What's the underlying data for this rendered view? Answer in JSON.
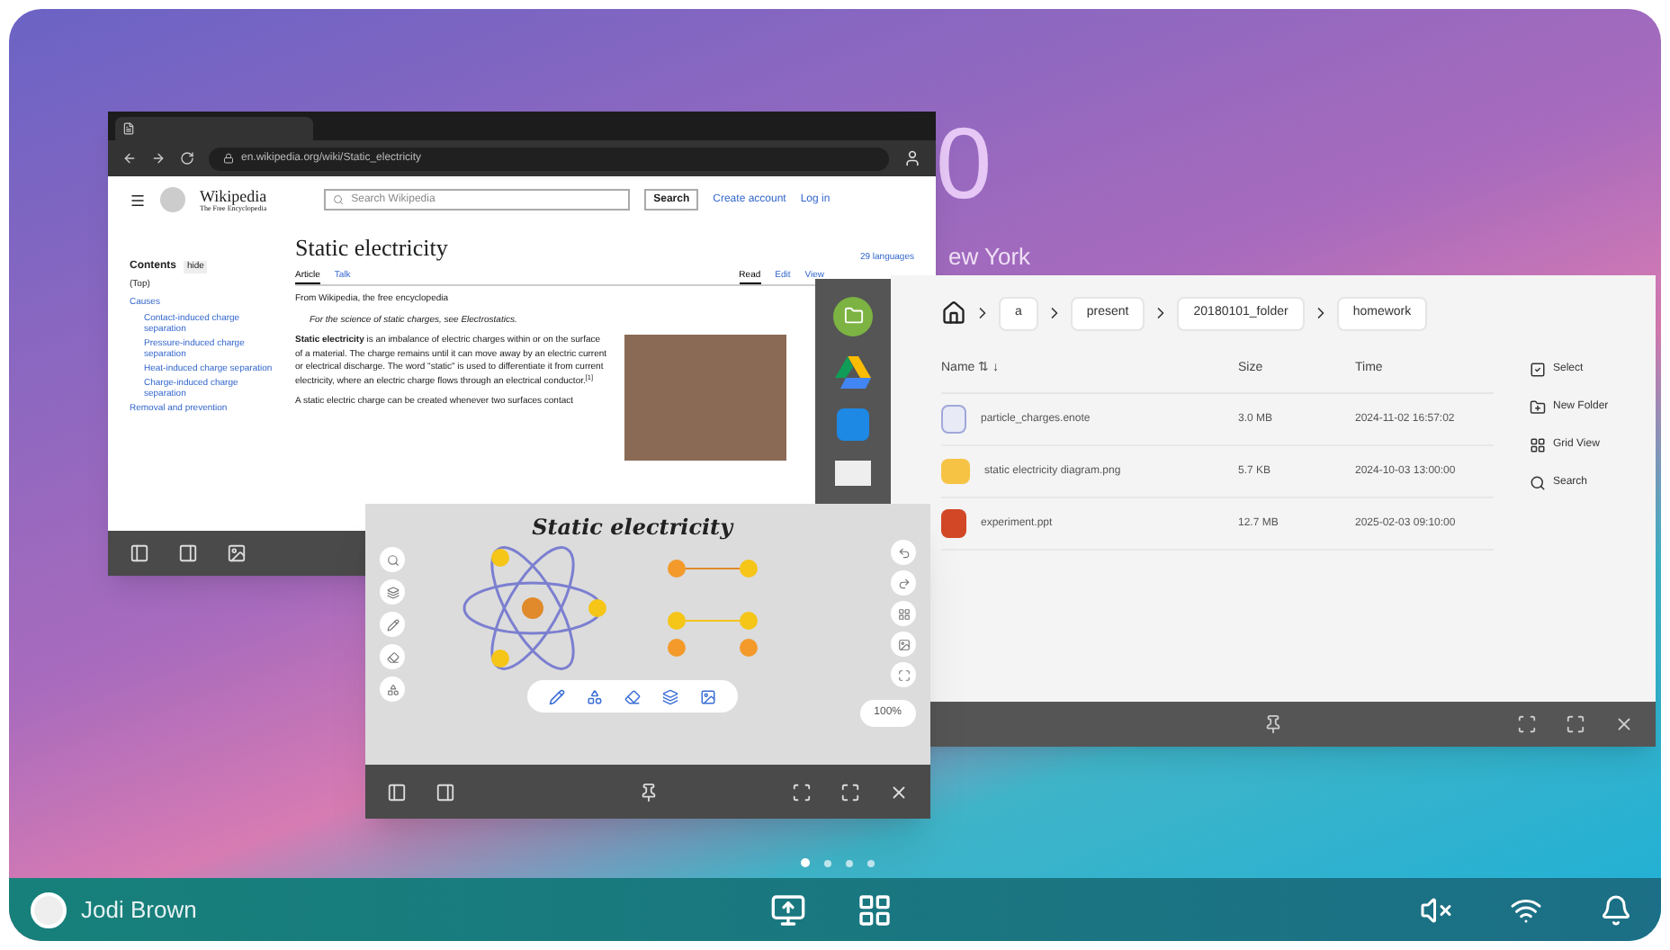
{
  "clock": {
    "time": "0",
    "city": "ew York"
  },
  "browser": {
    "url": "en.wikipedia.org/wiki/Static_electricity",
    "wiki": {
      "logo": "Wikipedia",
      "logo_subtitle": "The Free Encyclopedia",
      "search_placeholder": "Search Wikipedia",
      "search_button": "Search",
      "links": [
        "Create account",
        "Log in"
      ],
      "title": "Static electricity",
      "languages": "29 languages",
      "toc_title": "Contents",
      "toc_hide": "hide",
      "toc": [
        {
          "label": "(Top)"
        },
        {
          "label": "Causes",
          "children": [
            {
              "label": "Contact-induced charge separation"
            },
            {
              "label": "Pressure-induced charge separation"
            },
            {
              "label": "Heat-induced charge separation"
            },
            {
              "label": "Charge-induced charge separation"
            }
          ]
        },
        {
          "label": "Removal and prevention"
        }
      ],
      "tabs_left": [
        {
          "label": "Article",
          "selected": true
        },
        {
          "label": "Talk",
          "selected": false
        }
      ],
      "tabs_right": [
        {
          "label": "Read",
          "selected": true
        },
        {
          "label": "Edit",
          "selected": false
        },
        {
          "label": "View",
          "selected": false
        }
      ],
      "tagline": "From Wikipedia, the free encyclopedia",
      "hatnote": "For the science of static charges, see Electrostatics.",
      "paragraphs": [
        "**Static electricity** is an imbalance of electric charges within or on the surface of a material. The charge remains until it can move away by an electric current or electrical discharge. The word \"static\" is used to differentiate it from current electricity, where an electric charge flows through an electrical conductor.$^{[1]}$",
        "A static electric charge can be created whenever two surfaces contact"
      ]
    }
  },
  "files": {
    "breadcrumb": [
      "a",
      "present",
      "20180101_folder",
      "homework"
    ],
    "columns": [
      "Name ⇅ ↓",
      "Size",
      "Time"
    ],
    "rows": [
      {
        "kind": "note",
        "name": "particle_charges.enote",
        "size": "3.0 MB",
        "time": "2024-11-02 16:57:02"
      },
      {
        "kind": "image",
        "name": "static electricity diagram.png",
        "size": "5.7 KB",
        "time": "2024-10-03 13:00:00"
      },
      {
        "kind": "slides",
        "name": "experiment.ppt",
        "size": "12.7 MB",
        "time": "2025-02-03 09:10:00"
      }
    ],
    "actions": [
      "Select",
      "New Folder",
      "Grid View",
      "Search"
    ]
  },
  "whiteboard": {
    "title": "Static electricity",
    "zoom": "100%"
  },
  "pages": [
    {
      "selected": true
    },
    {
      "selected": false
    },
    {
      "selected": false
    },
    {
      "selected": false
    }
  ],
  "taskbar": {
    "user": "Jodi Brown"
  }
}
